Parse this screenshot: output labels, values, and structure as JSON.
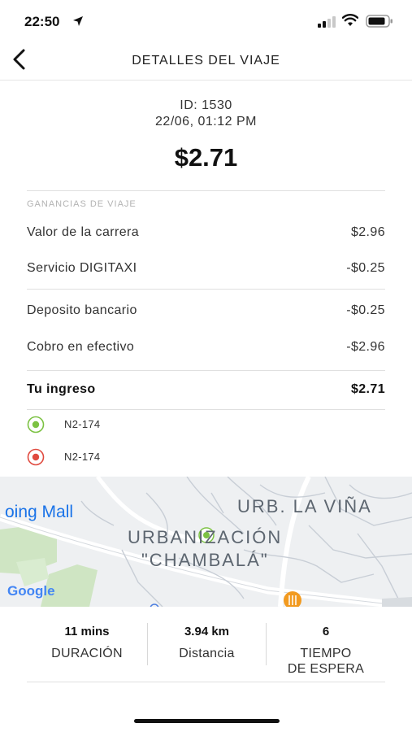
{
  "status_bar": {
    "time": "22:50"
  },
  "nav": {
    "title": "DETALLES DEL VIAJE"
  },
  "trip": {
    "id_line": "ID: 1530",
    "datetime": "22/06, 01:12 PM",
    "total": "$2.71"
  },
  "earnings": {
    "section_label": "GANANCIAS DE VIAJE",
    "rows": [
      {
        "label": "Valor de la carrera",
        "value": "$2.96"
      },
      {
        "label": "Servicio DIGITAXI",
        "value": "-$0.25"
      },
      {
        "label": "Deposito bancario",
        "value": "-$0.25"
      },
      {
        "label": "Cobro en efectivo",
        "value": "-$2.96"
      }
    ],
    "income": {
      "label": "Tu ingreso",
      "value": "$2.71"
    }
  },
  "locations": {
    "origin": {
      "text": "N2-174",
      "color": "#7cc243"
    },
    "destination": {
      "text": "N2-174",
      "color": "#e04a3f"
    }
  },
  "map": {
    "labels": {
      "mall": "oing Mall",
      "urb_la_vina": "URB. LA VIÑA",
      "urbanizacion": "URBANIZACIÓN",
      "chambala": "\"CHAMBALÁ\""
    },
    "google": "Google"
  },
  "stats": {
    "duration": {
      "value": "11 mins",
      "label": "DURACIÓN"
    },
    "distance": {
      "value": "3.94 km",
      "label": "Distancia"
    },
    "wait": {
      "value": "6",
      "label_line1": "TIEMPO",
      "label_line2": "DE ESPERA"
    }
  }
}
